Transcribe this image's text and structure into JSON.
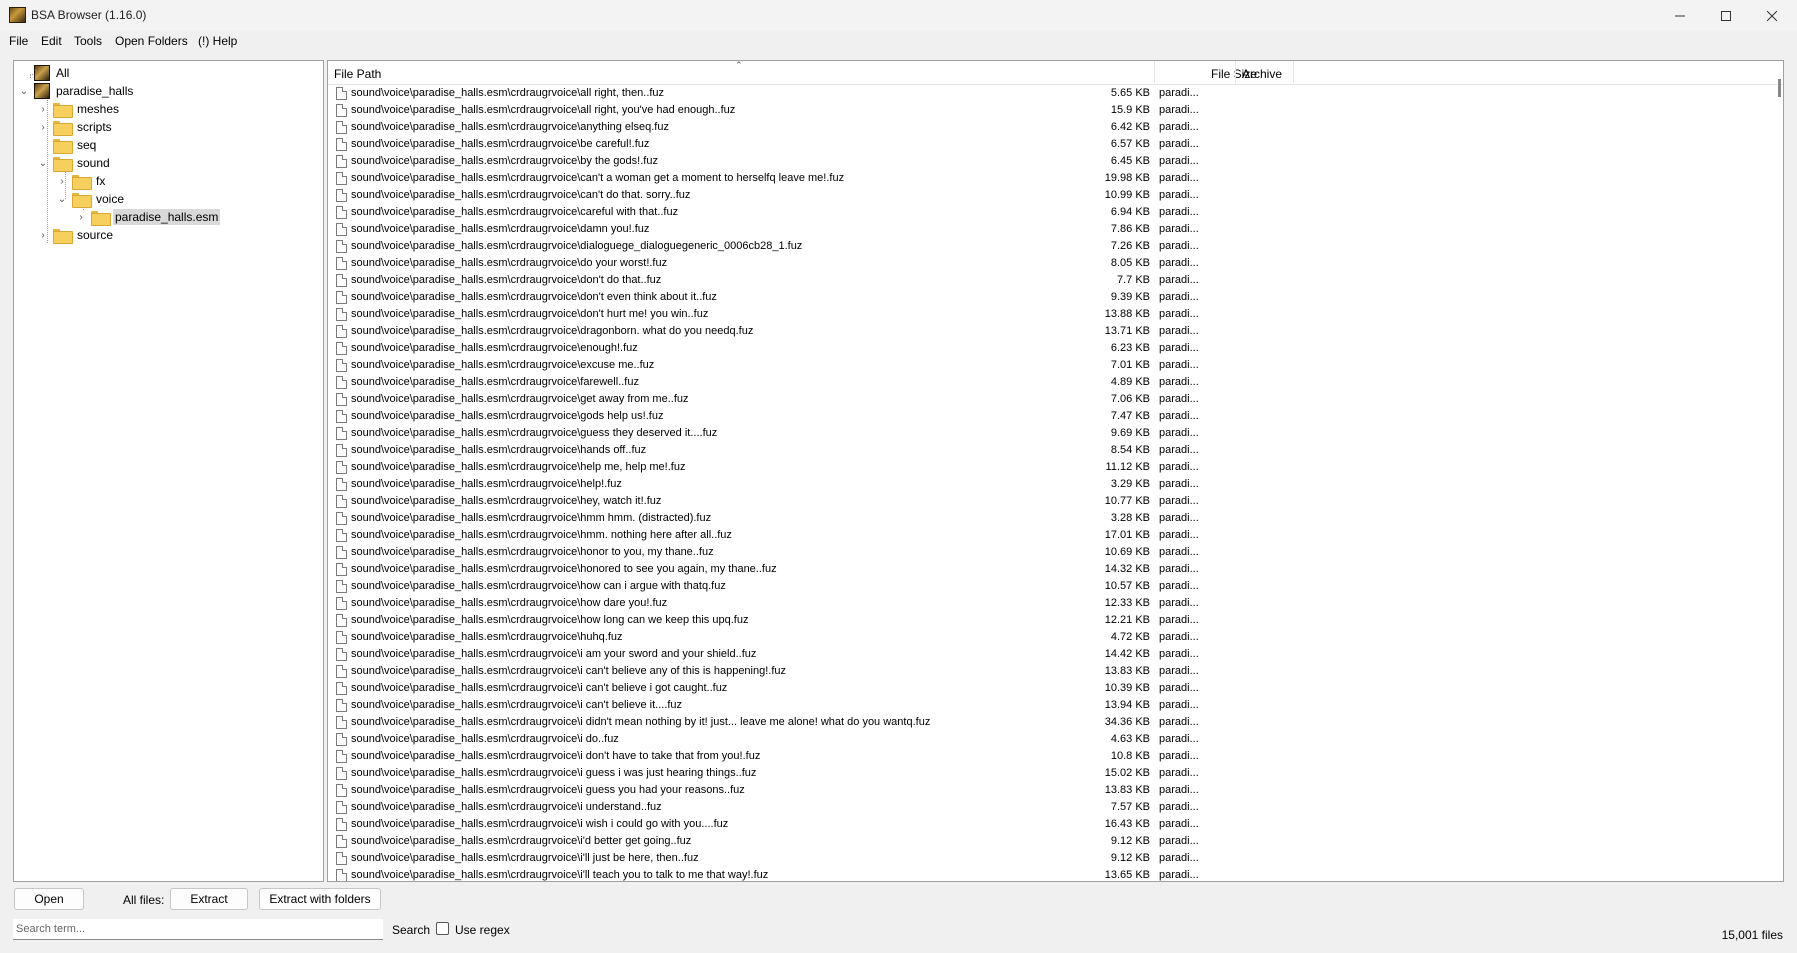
{
  "window": {
    "title": "BSA Browser (1.16.0)"
  },
  "menu": [
    "File",
    "Edit",
    "Tools",
    "Open Folders",
    "(!) Help"
  ],
  "tree": [
    {
      "label": "All",
      "icon": "bsa-archive-icon"
    },
    {
      "label": "paradise_halls",
      "icon": "bsa-archive-icon",
      "expanded": true
    },
    {
      "label": "meshes",
      "icon": "folder-icon"
    },
    {
      "label": "scripts",
      "icon": "folder-icon"
    },
    {
      "label": "seq",
      "icon": "folder-icon"
    },
    {
      "label": "sound",
      "icon": "folder-icon",
      "expanded": true
    },
    {
      "label": "fx",
      "icon": "folder-icon"
    },
    {
      "label": "voice",
      "icon": "folder-icon",
      "expanded": true
    },
    {
      "label": "paradise_halls.esm",
      "icon": "folder-icon",
      "selected": true
    },
    {
      "label": "source",
      "icon": "folder-icon"
    }
  ],
  "list": {
    "columns": {
      "path": "File Path",
      "size": "File Size",
      "archive": "Archive"
    },
    "rows": [
      {
        "path": "sound\\voice\\paradise_halls.esm\\crdraugrvoice\\all right, then..fuz",
        "size": "5.65 KB",
        "archive": "paradi..."
      },
      {
        "path": "sound\\voice\\paradise_halls.esm\\crdraugrvoice\\all right, you've had enough..fuz",
        "size": "15.9 KB",
        "archive": "paradi..."
      },
      {
        "path": "sound\\voice\\paradise_halls.esm\\crdraugrvoice\\anything elseq.fuz",
        "size": "6.42 KB",
        "archive": "paradi..."
      },
      {
        "path": "sound\\voice\\paradise_halls.esm\\crdraugrvoice\\be careful!.fuz",
        "size": "6.57 KB",
        "archive": "paradi..."
      },
      {
        "path": "sound\\voice\\paradise_halls.esm\\crdraugrvoice\\by the gods!.fuz",
        "size": "6.45 KB",
        "archive": "paradi..."
      },
      {
        "path": "sound\\voice\\paradise_halls.esm\\crdraugrvoice\\can't a woman get a moment to herselfq leave me!.fuz",
        "size": "19.98 KB",
        "archive": "paradi..."
      },
      {
        "path": "sound\\voice\\paradise_halls.esm\\crdraugrvoice\\can't do that. sorry..fuz",
        "size": "10.99 KB",
        "archive": "paradi..."
      },
      {
        "path": "sound\\voice\\paradise_halls.esm\\crdraugrvoice\\careful with that..fuz",
        "size": "6.94 KB",
        "archive": "paradi..."
      },
      {
        "path": "sound\\voice\\paradise_halls.esm\\crdraugrvoice\\damn you!.fuz",
        "size": "7.86 KB",
        "archive": "paradi..."
      },
      {
        "path": "sound\\voice\\paradise_halls.esm\\crdraugrvoice\\dialoguege_dialoguegeneric_0006cb28_1.fuz",
        "size": "7.26 KB",
        "archive": "paradi..."
      },
      {
        "path": "sound\\voice\\paradise_halls.esm\\crdraugrvoice\\do your worst!.fuz",
        "size": "8.05 KB",
        "archive": "paradi..."
      },
      {
        "path": "sound\\voice\\paradise_halls.esm\\crdraugrvoice\\don't do that..fuz",
        "size": "7.7 KB",
        "archive": "paradi..."
      },
      {
        "path": "sound\\voice\\paradise_halls.esm\\crdraugrvoice\\don't even think about it..fuz",
        "size": "9.39 KB",
        "archive": "paradi..."
      },
      {
        "path": "sound\\voice\\paradise_halls.esm\\crdraugrvoice\\don't hurt me! you win..fuz",
        "size": "13.88 KB",
        "archive": "paradi..."
      },
      {
        "path": "sound\\voice\\paradise_halls.esm\\crdraugrvoice\\dragonborn. what do you needq.fuz",
        "size": "13.71 KB",
        "archive": "paradi..."
      },
      {
        "path": "sound\\voice\\paradise_halls.esm\\crdraugrvoice\\enough!.fuz",
        "size": "6.23 KB",
        "archive": "paradi..."
      },
      {
        "path": "sound\\voice\\paradise_halls.esm\\crdraugrvoice\\excuse me..fuz",
        "size": "7.01 KB",
        "archive": "paradi..."
      },
      {
        "path": "sound\\voice\\paradise_halls.esm\\crdraugrvoice\\farewell..fuz",
        "size": "4.89 KB",
        "archive": "paradi..."
      },
      {
        "path": "sound\\voice\\paradise_halls.esm\\crdraugrvoice\\get away from me..fuz",
        "size": "7.06 KB",
        "archive": "paradi..."
      },
      {
        "path": "sound\\voice\\paradise_halls.esm\\crdraugrvoice\\gods help us!.fuz",
        "size": "7.47 KB",
        "archive": "paradi..."
      },
      {
        "path": "sound\\voice\\paradise_halls.esm\\crdraugrvoice\\guess they deserved it....fuz",
        "size": "9.69 KB",
        "archive": "paradi..."
      },
      {
        "path": "sound\\voice\\paradise_halls.esm\\crdraugrvoice\\hands off..fuz",
        "size": "8.54 KB",
        "archive": "paradi..."
      },
      {
        "path": "sound\\voice\\paradise_halls.esm\\crdraugrvoice\\help me, help me!.fuz",
        "size": "11.12 KB",
        "archive": "paradi..."
      },
      {
        "path": "sound\\voice\\paradise_halls.esm\\crdraugrvoice\\help!.fuz",
        "size": "3.29 KB",
        "archive": "paradi..."
      },
      {
        "path": "sound\\voice\\paradise_halls.esm\\crdraugrvoice\\hey, watch it!.fuz",
        "size": "10.77 KB",
        "archive": "paradi..."
      },
      {
        "path": "sound\\voice\\paradise_halls.esm\\crdraugrvoice\\hmm hmm. (distracted).fuz",
        "size": "3.28 KB",
        "archive": "paradi..."
      },
      {
        "path": "sound\\voice\\paradise_halls.esm\\crdraugrvoice\\hmm. nothing here after all..fuz",
        "size": "17.01 KB",
        "archive": "paradi..."
      },
      {
        "path": "sound\\voice\\paradise_halls.esm\\crdraugrvoice\\honor to you, my thane..fuz",
        "size": "10.69 KB",
        "archive": "paradi..."
      },
      {
        "path": "sound\\voice\\paradise_halls.esm\\crdraugrvoice\\honored to see you again, my thane..fuz",
        "size": "14.32 KB",
        "archive": "paradi..."
      },
      {
        "path": "sound\\voice\\paradise_halls.esm\\crdraugrvoice\\how can i argue with thatq.fuz",
        "size": "10.57 KB",
        "archive": "paradi..."
      },
      {
        "path": "sound\\voice\\paradise_halls.esm\\crdraugrvoice\\how dare you!.fuz",
        "size": "12.33 KB",
        "archive": "paradi..."
      },
      {
        "path": "sound\\voice\\paradise_halls.esm\\crdraugrvoice\\how long can we keep this upq.fuz",
        "size": "12.21 KB",
        "archive": "paradi..."
      },
      {
        "path": "sound\\voice\\paradise_halls.esm\\crdraugrvoice\\huhq.fuz",
        "size": "4.72 KB",
        "archive": "paradi..."
      },
      {
        "path": "sound\\voice\\paradise_halls.esm\\crdraugrvoice\\i am your sword and your shield..fuz",
        "size": "14.42 KB",
        "archive": "paradi..."
      },
      {
        "path": "sound\\voice\\paradise_halls.esm\\crdraugrvoice\\i can't believe any of this is happening!.fuz",
        "size": "13.83 KB",
        "archive": "paradi..."
      },
      {
        "path": "sound\\voice\\paradise_halls.esm\\crdraugrvoice\\i can't believe i got caught..fuz",
        "size": "10.39 KB",
        "archive": "paradi..."
      },
      {
        "path": "sound\\voice\\paradise_halls.esm\\crdraugrvoice\\i can't believe it....fuz",
        "size": "13.94 KB",
        "archive": "paradi..."
      },
      {
        "path": "sound\\voice\\paradise_halls.esm\\crdraugrvoice\\i didn't mean nothing by it! just... leave me alone! what do you wantq.fuz",
        "size": "34.36 KB",
        "archive": "paradi..."
      },
      {
        "path": "sound\\voice\\paradise_halls.esm\\crdraugrvoice\\i do..fuz",
        "size": "4.63 KB",
        "archive": "paradi..."
      },
      {
        "path": "sound\\voice\\paradise_halls.esm\\crdraugrvoice\\i don't have to take that from you!.fuz",
        "size": "10.8 KB",
        "archive": "paradi..."
      },
      {
        "path": "sound\\voice\\paradise_halls.esm\\crdraugrvoice\\i guess i was just hearing things..fuz",
        "size": "15.02 KB",
        "archive": "paradi..."
      },
      {
        "path": "sound\\voice\\paradise_halls.esm\\crdraugrvoice\\i guess you had your reasons..fuz",
        "size": "13.83 KB",
        "archive": "paradi..."
      },
      {
        "path": "sound\\voice\\paradise_halls.esm\\crdraugrvoice\\i understand..fuz",
        "size": "7.57 KB",
        "archive": "paradi..."
      },
      {
        "path": "sound\\voice\\paradise_halls.esm\\crdraugrvoice\\i wish i could go with you....fuz",
        "size": "16.43 KB",
        "archive": "paradi..."
      },
      {
        "path": "sound\\voice\\paradise_halls.esm\\crdraugrvoice\\i'd better get going..fuz",
        "size": "9.12 KB",
        "archive": "paradi..."
      },
      {
        "path": "sound\\voice\\paradise_halls.esm\\crdraugrvoice\\i'll just be here, then..fuz",
        "size": "9.12 KB",
        "archive": "paradi..."
      },
      {
        "path": "sound\\voice\\paradise_halls.esm\\crdraugrvoice\\i'll teach you to talk to me that way!.fuz",
        "size": "13.65 KB",
        "archive": "paradi..."
      }
    ]
  },
  "bottom": {
    "open": "Open",
    "all_files": "All files:",
    "extract": "Extract",
    "extract_folders": "Extract with folders",
    "search_placeholder": "Search term...",
    "search": "Search",
    "use_regex": "Use regex",
    "use_regex_checked": false,
    "file_count": "15,001 files"
  }
}
